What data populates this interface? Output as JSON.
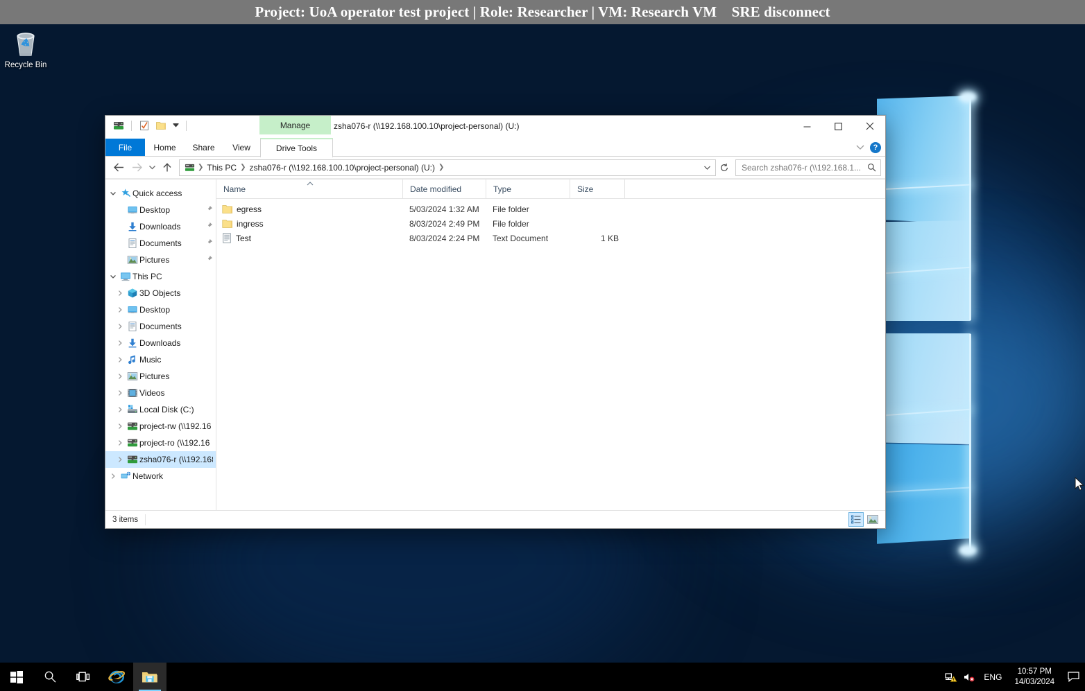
{
  "banner": {
    "text": "Project: UoA operator test project | Role: Researcher | VM: Research VM    SRE disconnect",
    "bg_color": "#787878",
    "text_color": "#ffffff"
  },
  "desktop": {
    "icons": [
      {
        "name": "recycle-bin",
        "label": "Recycle Bin"
      }
    ]
  },
  "explorer": {
    "window_title": "zsha076-r (\\\\192.168.100.10\\project-personal) (U:)",
    "quick_access_toolbar": [
      {
        "name": "network-drive-icon",
        "label": ""
      },
      {
        "name": "properties-icon",
        "label": ""
      },
      {
        "name": "new-folder-icon",
        "label": ""
      },
      {
        "name": "customize-caret-icon",
        "label": ""
      }
    ],
    "contextual_tab_group": "Manage",
    "ribbon_tabs": [
      {
        "label": "File",
        "active": false,
        "accent": true
      },
      {
        "label": "Home",
        "active": false
      },
      {
        "label": "Share",
        "active": false
      },
      {
        "label": "View",
        "active": false
      },
      {
        "label": "Drive Tools",
        "active": true,
        "contextual": true
      }
    ],
    "ribbon_right": {
      "collapse_icon": "chevron-down-icon",
      "help_label": "?"
    },
    "window_controls": {
      "minimize": "–",
      "maximize": "□",
      "close": "×"
    },
    "address_bar": {
      "back_label": "←",
      "forward_label": "→",
      "recent_label": "⌄",
      "up_label": "↑",
      "refresh_label": "↻",
      "crumbs": [
        "This PC",
        "zsha076-r (\\\\192.168.100.10\\project-personal) (U:)"
      ]
    },
    "search": {
      "value": "",
      "placeholder": "Search zsha076-r (\\\\192.168.1..."
    },
    "nav_pane": [
      {
        "label": "Quick access",
        "icon": "star-pin-icon",
        "level": 0,
        "chevron": "expanded",
        "pinned": false,
        "selected": false
      },
      {
        "label": "Desktop",
        "icon": "desktop-icon",
        "level": 1,
        "chevron": "none",
        "pinned": true,
        "selected": false
      },
      {
        "label": "Downloads",
        "icon": "downloads-icon",
        "level": 1,
        "chevron": "none",
        "pinned": true,
        "selected": false
      },
      {
        "label": "Documents",
        "icon": "documents-icon",
        "level": 1,
        "chevron": "none",
        "pinned": true,
        "selected": false
      },
      {
        "label": "Pictures",
        "icon": "pictures-icon",
        "level": 1,
        "chevron": "none",
        "pinned": true,
        "selected": false
      },
      {
        "label": "This PC",
        "icon": "this-pc-icon",
        "level": 0,
        "chevron": "expanded",
        "pinned": false,
        "selected": false
      },
      {
        "label": "3D Objects",
        "icon": "3d-objects-icon",
        "level": 1,
        "chevron": "collapsed",
        "pinned": false,
        "selected": false
      },
      {
        "label": "Desktop",
        "icon": "desktop-icon",
        "level": 1,
        "chevron": "collapsed",
        "pinned": false,
        "selected": false
      },
      {
        "label": "Documents",
        "icon": "documents-icon",
        "level": 1,
        "chevron": "collapsed",
        "pinned": false,
        "selected": false
      },
      {
        "label": "Downloads",
        "icon": "downloads-icon",
        "level": 1,
        "chevron": "collapsed",
        "pinned": false,
        "selected": false
      },
      {
        "label": "Music",
        "icon": "music-icon",
        "level": 1,
        "chevron": "collapsed",
        "pinned": false,
        "selected": false
      },
      {
        "label": "Pictures",
        "icon": "pictures-icon",
        "level": 1,
        "chevron": "collapsed",
        "pinned": false,
        "selected": false
      },
      {
        "label": "Videos",
        "icon": "videos-icon",
        "level": 1,
        "chevron": "collapsed",
        "pinned": false,
        "selected": false
      },
      {
        "label": "Local Disk (C:)",
        "icon": "local-disk-icon",
        "level": 1,
        "chevron": "collapsed",
        "pinned": false,
        "selected": false
      },
      {
        "label": "project-rw (\\\\192.16",
        "icon": "network-drive-icon",
        "level": 1,
        "chevron": "collapsed",
        "pinned": false,
        "selected": false
      },
      {
        "label": "project-ro (\\\\192.16",
        "icon": "network-drive-icon",
        "level": 1,
        "chevron": "collapsed",
        "pinned": false,
        "selected": false
      },
      {
        "label": "zsha076-r (\\\\192.168",
        "icon": "network-drive-icon",
        "level": 1,
        "chevron": "collapsed",
        "pinned": false,
        "selected": true
      },
      {
        "label": "Network",
        "icon": "network-icon",
        "level": 0,
        "chevron": "collapsed",
        "pinned": false,
        "selected": false
      }
    ],
    "columns": [
      {
        "key": "name",
        "label": "Name",
        "sorted": true,
        "sort_dir": "asc"
      },
      {
        "key": "date",
        "label": "Date modified"
      },
      {
        "key": "type",
        "label": "Type"
      },
      {
        "key": "size",
        "label": "Size"
      }
    ],
    "files": [
      {
        "name": "egress",
        "icon": "folder-icon",
        "date": "5/03/2024 1:32 AM",
        "type": "File folder",
        "size": ""
      },
      {
        "name": "ingress",
        "icon": "folder-icon",
        "date": "8/03/2024 2:49 PM",
        "type": "File folder",
        "size": ""
      },
      {
        "name": "Test",
        "icon": "text-document-icon",
        "date": "8/03/2024 2:24 PM",
        "type": "Text Document",
        "size": "1 KB"
      }
    ],
    "status": {
      "item_count": "3 items",
      "view_buttons": [
        {
          "name": "details-view-button",
          "active": true
        },
        {
          "name": "large-icons-view-button",
          "active": false
        }
      ]
    }
  },
  "taskbar": {
    "buttons": [
      {
        "name": "start-button",
        "icon": "windows-logo-icon"
      },
      {
        "name": "search-button",
        "icon": "search-icon"
      },
      {
        "name": "task-view-button",
        "icon": "task-view-icon"
      },
      {
        "name": "internet-explorer-button",
        "icon": "internet-explorer-icon"
      },
      {
        "name": "file-explorer-button",
        "icon": "file-explorer-icon",
        "active": true
      }
    ],
    "tray": {
      "network_icon": "network-warning-icon",
      "volume_icon": "volume-muted-icon",
      "language": "ENG",
      "time": "10:57 PM",
      "date": "14/03/2024",
      "action_center_icon": "action-center-icon"
    }
  }
}
